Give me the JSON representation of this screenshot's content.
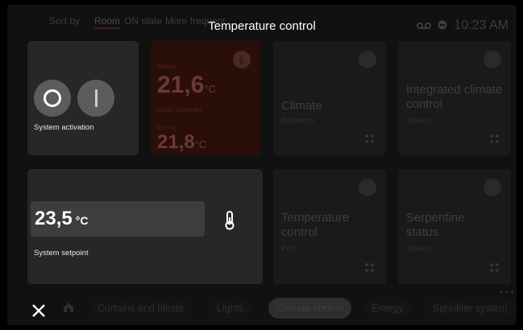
{
  "header": {
    "sort_label": "Sort by",
    "sort_options": [
      "Room",
      "ON state",
      "More frequent"
    ],
    "title": "Temperature control",
    "time": "10:23 AM",
    "status_icons": [
      "voicemail-icon",
      "cloud-icon"
    ]
  },
  "background": {
    "thermostat": {
      "now_label": "NOW AT",
      "now_value": "21,6",
      "unit": "°C",
      "mode_label": "MODE: ECONOMY",
      "set_label": "SET TO",
      "set_value": "21,8"
    },
    "tiles": [
      {
        "name": "Climate",
        "room": "Bedroom"
      },
      {
        "name": "Integrated climate control",
        "room": "Tavern"
      },
      {
        "name": "Temperature control",
        "room": "Pool"
      },
      {
        "name": "Serpentine status",
        "room": "Tavern"
      }
    ]
  },
  "overlay": {
    "activation_label": "System activation",
    "setpoint_value": "23,5",
    "setpoint_unit": "°C",
    "setpoint_label": "System setpoint"
  },
  "bottom_nav": {
    "items": [
      "Curtains and blinds",
      "Lights",
      "Climate control",
      "Energy",
      "Sprinkler system"
    ],
    "selected": "Climate control"
  },
  "colors": {
    "panel": "#272727",
    "field": "#3d3d3d",
    "round_button": "#5c5c5c",
    "accent_red": "#4a1a12"
  }
}
